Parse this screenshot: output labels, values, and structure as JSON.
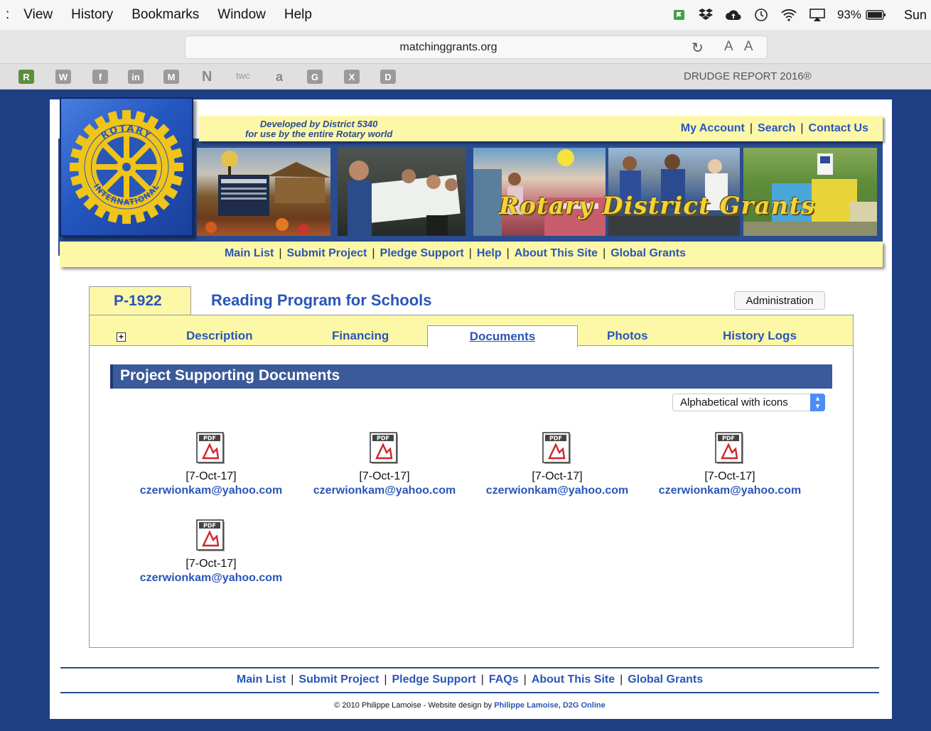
{
  "menubar": {
    "items": [
      "View",
      "History",
      "Bookmarks",
      "Window",
      "Help"
    ],
    "battery": "93%",
    "day": "Sun"
  },
  "browser": {
    "url": "matchinggrants.org",
    "bookmarks": [
      "R",
      "W",
      "f",
      "in",
      "M",
      "N",
      "twc",
      "a",
      "G",
      "X",
      "D"
    ],
    "bookmark_right": "DRUDGE REPORT 2016®"
  },
  "header": {
    "tagline_line1": "Developed by District 5340",
    "tagline_line2": "for use by the entire Rotary world",
    "top_links": [
      "My Account",
      "Search",
      "Contact Us"
    ],
    "banner_title": "Rotary District Grants",
    "nav_links": [
      "Main List",
      "Submit Project",
      "Pledge Support",
      "Help",
      "About This Site",
      "Global Grants"
    ]
  },
  "project": {
    "id": "P-1922",
    "title": "Reading Program for Schools",
    "admin_label": "Administration",
    "expand_symbol": "+",
    "tabs": [
      "Description",
      "Financing",
      "Documents",
      "Photos",
      "History Logs"
    ],
    "active_tab": "Documents"
  },
  "documents": {
    "section_title": "Project Supporting Documents",
    "sort_value": "Alphabetical with icons",
    "items": [
      {
        "date": "[7-Oct-17]",
        "email": "czerwionkam@yahoo.com"
      },
      {
        "date": "[7-Oct-17]",
        "email": "czerwionkam@yahoo.com"
      },
      {
        "date": "[7-Oct-17]",
        "email": "czerwionkam@yahoo.com"
      },
      {
        "date": "[7-Oct-17]",
        "email": "czerwionkam@yahoo.com"
      },
      {
        "date": "[7-Oct-17]",
        "email": "czerwionkam@yahoo.com"
      }
    ]
  },
  "footer": {
    "nav_links": [
      "Main List",
      "Submit Project",
      "Pledge Support",
      "FAQs",
      "About This Site",
      "Global Grants"
    ],
    "copyright_prefix": "© 2010 Philippe Lamoise - Website design by",
    "copyright_link": "Philippe Lamoise, D2G Online"
  },
  "colors": {
    "brand_blue": "#2a4c91",
    "link_blue": "#2a56b8",
    "yellow_panel": "#fdf8a8",
    "rotary_gold": "#f0c419"
  }
}
